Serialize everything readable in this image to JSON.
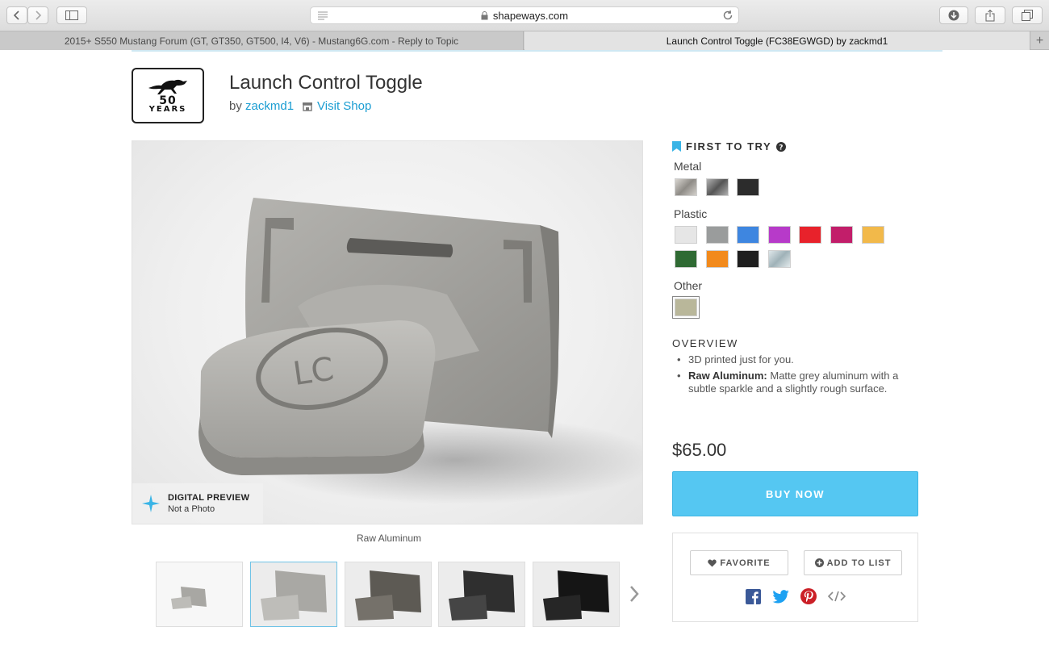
{
  "browser": {
    "url": "shapeways.com",
    "tabs": [
      {
        "label": "2015+ S550 Mustang Forum (GT, GT350, GT500, I4, V6) - Mustang6G.com - Reply to Topic"
      },
      {
        "label": "Launch Control Toggle (FC38EGWGD) by zackmd1"
      }
    ],
    "new_tab": "+"
  },
  "logo": {
    "line1": "50",
    "line2": "YEARS"
  },
  "product": {
    "title": "Launch Control Toggle",
    "by": "by",
    "author": "zackmd1",
    "visit_shop": "Visit Shop",
    "price": "$65.00",
    "buy_label": "BUY NOW",
    "favorite_label": "FAVORITE",
    "add_to_list_label": "ADD TO LIST"
  },
  "image": {
    "badge_title": "DIGITAL PREVIEW",
    "badge_subtitle": "Not a Photo",
    "caption": "Raw Aluminum"
  },
  "materials": {
    "first_to_try": "FIRST TO TRY",
    "groups": [
      {
        "label": "Metal",
        "swatches": [
          "#b9b5b0",
          "#8d8d8d",
          "#2c2c2c"
        ]
      },
      {
        "label": "Plastic",
        "swatches": [
          "#e6e6e6",
          "#9a9c9c",
          "#3e86e0",
          "#b73ac9",
          "#e8222b",
          "#c21e6a",
          "#f2b94a",
          "#2f6a33",
          "#f28a1c",
          "#1e1e1e",
          "#b9c7cc"
        ]
      },
      {
        "label": "Other",
        "swatches": [
          "#b9b79a"
        ]
      }
    ]
  },
  "overview": {
    "heading": "OVERVIEW",
    "item1": "3D printed just for you.",
    "item2_bold": "Raw Aluminum:",
    "item2_text": " Matte grey aluminum with a subtle sparkle and a slightly rough surface."
  },
  "colors": {
    "accent": "#55c7f2",
    "link": "#1a9dd2"
  },
  "icons": [
    "back-icon",
    "forward-icon",
    "sidebar-icon",
    "lock-icon",
    "reload-icon",
    "download-icon",
    "share-icon",
    "tabs-icon",
    "shop-icon",
    "flag-icon",
    "help-icon",
    "star-icon",
    "chevron-right-icon",
    "heart-icon",
    "plus-circle-icon",
    "facebook-icon",
    "twitter-icon",
    "pinterest-icon",
    "embed-icon"
  ]
}
